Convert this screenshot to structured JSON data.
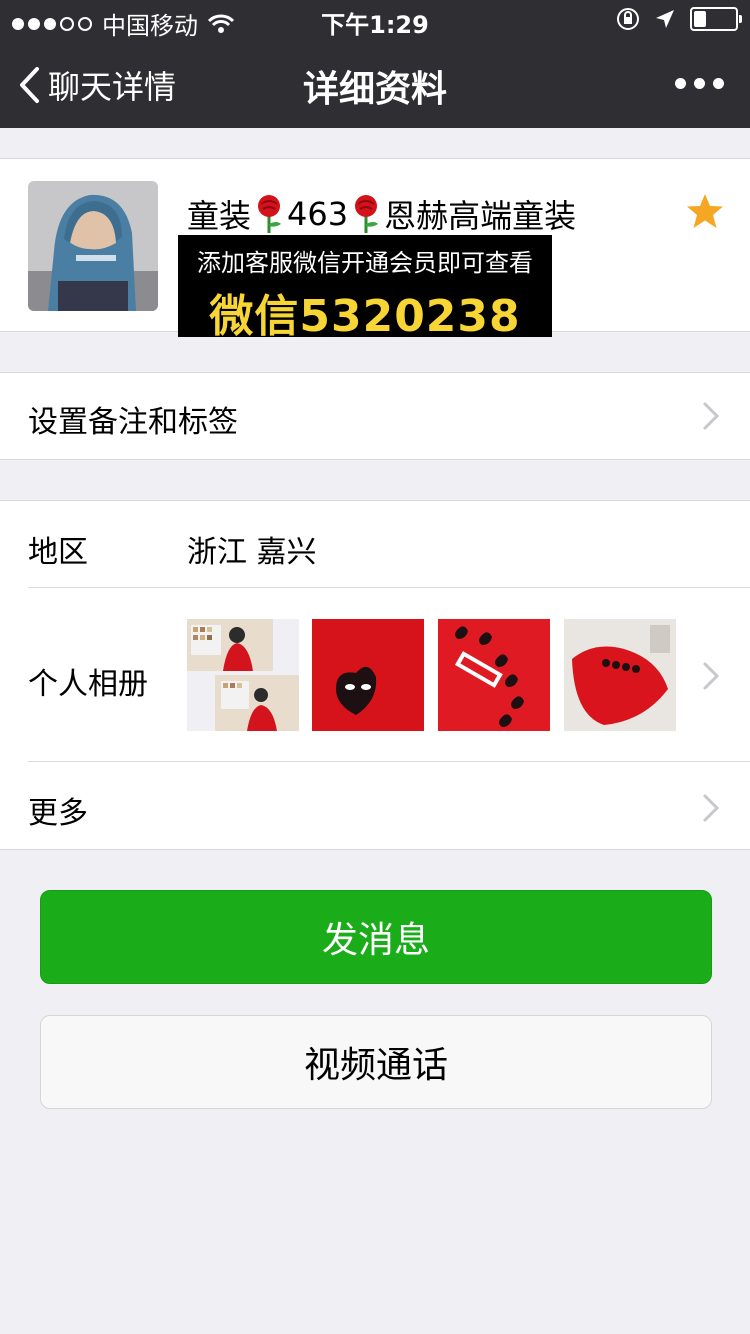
{
  "status_bar": {
    "carrier": "中国移动",
    "time": "下午1:29"
  },
  "nav": {
    "back_label": "聊天详情",
    "title": "详细资料"
  },
  "profile": {
    "nickname_prefix": "童装",
    "nickname_number": "463",
    "nickname_suffix": "恩赫高端童装",
    "promo_line1": "添加客服微信开通会员即可查看",
    "promo_line2": "微信5320238"
  },
  "remark_row": {
    "label": "设置备注和标签"
  },
  "region": {
    "label": "地区",
    "value": "浙江 嘉兴"
  },
  "album": {
    "label": "个人相册"
  },
  "more_row": {
    "label": "更多"
  },
  "buttons": {
    "send": "发消息",
    "video_call": "视频通话"
  },
  "colors": {
    "accent_green": "#1aad19",
    "nav_bg": "#2f2f33",
    "star": "#f5a623"
  }
}
